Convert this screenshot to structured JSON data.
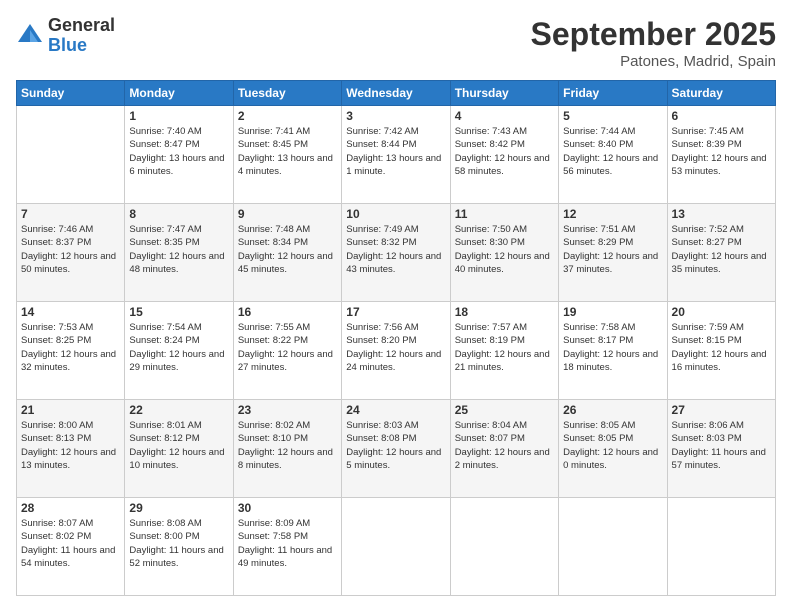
{
  "logo": {
    "general": "General",
    "blue": "Blue"
  },
  "header": {
    "month": "September 2025",
    "location": "Patones, Madrid, Spain"
  },
  "weekdays": [
    "Sunday",
    "Monday",
    "Tuesday",
    "Wednesday",
    "Thursday",
    "Friday",
    "Saturday"
  ],
  "weeks": [
    [
      {
        "day": "",
        "sunrise": "",
        "sunset": "",
        "daylight": ""
      },
      {
        "day": "1",
        "sunrise": "Sunrise: 7:40 AM",
        "sunset": "Sunset: 8:47 PM",
        "daylight": "Daylight: 13 hours and 6 minutes."
      },
      {
        "day": "2",
        "sunrise": "Sunrise: 7:41 AM",
        "sunset": "Sunset: 8:45 PM",
        "daylight": "Daylight: 13 hours and 4 minutes."
      },
      {
        "day": "3",
        "sunrise": "Sunrise: 7:42 AM",
        "sunset": "Sunset: 8:44 PM",
        "daylight": "Daylight: 13 hours and 1 minute."
      },
      {
        "day": "4",
        "sunrise": "Sunrise: 7:43 AM",
        "sunset": "Sunset: 8:42 PM",
        "daylight": "Daylight: 12 hours and 58 minutes."
      },
      {
        "day": "5",
        "sunrise": "Sunrise: 7:44 AM",
        "sunset": "Sunset: 8:40 PM",
        "daylight": "Daylight: 12 hours and 56 minutes."
      },
      {
        "day": "6",
        "sunrise": "Sunrise: 7:45 AM",
        "sunset": "Sunset: 8:39 PM",
        "daylight": "Daylight: 12 hours and 53 minutes."
      }
    ],
    [
      {
        "day": "7",
        "sunrise": "Sunrise: 7:46 AM",
        "sunset": "Sunset: 8:37 PM",
        "daylight": "Daylight: 12 hours and 50 minutes."
      },
      {
        "day": "8",
        "sunrise": "Sunrise: 7:47 AM",
        "sunset": "Sunset: 8:35 PM",
        "daylight": "Daylight: 12 hours and 48 minutes."
      },
      {
        "day": "9",
        "sunrise": "Sunrise: 7:48 AM",
        "sunset": "Sunset: 8:34 PM",
        "daylight": "Daylight: 12 hours and 45 minutes."
      },
      {
        "day": "10",
        "sunrise": "Sunrise: 7:49 AM",
        "sunset": "Sunset: 8:32 PM",
        "daylight": "Daylight: 12 hours and 43 minutes."
      },
      {
        "day": "11",
        "sunrise": "Sunrise: 7:50 AM",
        "sunset": "Sunset: 8:30 PM",
        "daylight": "Daylight: 12 hours and 40 minutes."
      },
      {
        "day": "12",
        "sunrise": "Sunrise: 7:51 AM",
        "sunset": "Sunset: 8:29 PM",
        "daylight": "Daylight: 12 hours and 37 minutes."
      },
      {
        "day": "13",
        "sunrise": "Sunrise: 7:52 AM",
        "sunset": "Sunset: 8:27 PM",
        "daylight": "Daylight: 12 hours and 35 minutes."
      }
    ],
    [
      {
        "day": "14",
        "sunrise": "Sunrise: 7:53 AM",
        "sunset": "Sunset: 8:25 PM",
        "daylight": "Daylight: 12 hours and 32 minutes."
      },
      {
        "day": "15",
        "sunrise": "Sunrise: 7:54 AM",
        "sunset": "Sunset: 8:24 PM",
        "daylight": "Daylight: 12 hours and 29 minutes."
      },
      {
        "day": "16",
        "sunrise": "Sunrise: 7:55 AM",
        "sunset": "Sunset: 8:22 PM",
        "daylight": "Daylight: 12 hours and 27 minutes."
      },
      {
        "day": "17",
        "sunrise": "Sunrise: 7:56 AM",
        "sunset": "Sunset: 8:20 PM",
        "daylight": "Daylight: 12 hours and 24 minutes."
      },
      {
        "day": "18",
        "sunrise": "Sunrise: 7:57 AM",
        "sunset": "Sunset: 8:19 PM",
        "daylight": "Daylight: 12 hours and 21 minutes."
      },
      {
        "day": "19",
        "sunrise": "Sunrise: 7:58 AM",
        "sunset": "Sunset: 8:17 PM",
        "daylight": "Daylight: 12 hours and 18 minutes."
      },
      {
        "day": "20",
        "sunrise": "Sunrise: 7:59 AM",
        "sunset": "Sunset: 8:15 PM",
        "daylight": "Daylight: 12 hours and 16 minutes."
      }
    ],
    [
      {
        "day": "21",
        "sunrise": "Sunrise: 8:00 AM",
        "sunset": "Sunset: 8:13 PM",
        "daylight": "Daylight: 12 hours and 13 minutes."
      },
      {
        "day": "22",
        "sunrise": "Sunrise: 8:01 AM",
        "sunset": "Sunset: 8:12 PM",
        "daylight": "Daylight: 12 hours and 10 minutes."
      },
      {
        "day": "23",
        "sunrise": "Sunrise: 8:02 AM",
        "sunset": "Sunset: 8:10 PM",
        "daylight": "Daylight: 12 hours and 8 minutes."
      },
      {
        "day": "24",
        "sunrise": "Sunrise: 8:03 AM",
        "sunset": "Sunset: 8:08 PM",
        "daylight": "Daylight: 12 hours and 5 minutes."
      },
      {
        "day": "25",
        "sunrise": "Sunrise: 8:04 AM",
        "sunset": "Sunset: 8:07 PM",
        "daylight": "Daylight: 12 hours and 2 minutes."
      },
      {
        "day": "26",
        "sunrise": "Sunrise: 8:05 AM",
        "sunset": "Sunset: 8:05 PM",
        "daylight": "Daylight: 12 hours and 0 minutes."
      },
      {
        "day": "27",
        "sunrise": "Sunrise: 8:06 AM",
        "sunset": "Sunset: 8:03 PM",
        "daylight": "Daylight: 11 hours and 57 minutes."
      }
    ],
    [
      {
        "day": "28",
        "sunrise": "Sunrise: 8:07 AM",
        "sunset": "Sunset: 8:02 PM",
        "daylight": "Daylight: 11 hours and 54 minutes."
      },
      {
        "day": "29",
        "sunrise": "Sunrise: 8:08 AM",
        "sunset": "Sunset: 8:00 PM",
        "daylight": "Daylight: 11 hours and 52 minutes."
      },
      {
        "day": "30",
        "sunrise": "Sunrise: 8:09 AM",
        "sunset": "Sunset: 7:58 PM",
        "daylight": "Daylight: 11 hours and 49 minutes."
      },
      {
        "day": "",
        "sunrise": "",
        "sunset": "",
        "daylight": ""
      },
      {
        "day": "",
        "sunrise": "",
        "sunset": "",
        "daylight": ""
      },
      {
        "day": "",
        "sunrise": "",
        "sunset": "",
        "daylight": ""
      },
      {
        "day": "",
        "sunrise": "",
        "sunset": "",
        "daylight": ""
      }
    ]
  ]
}
